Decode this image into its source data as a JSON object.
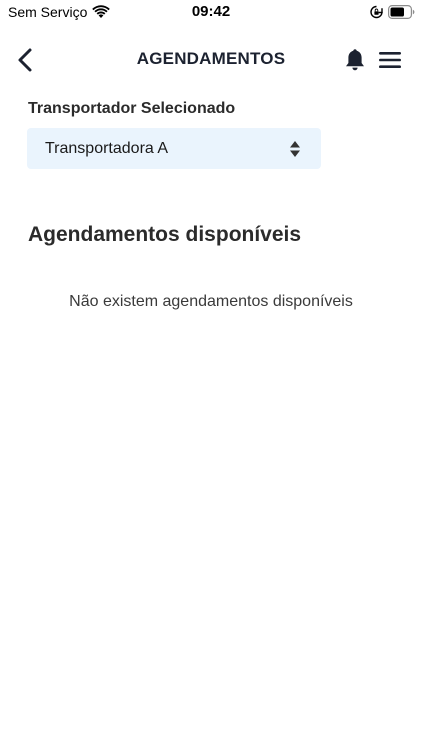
{
  "status_bar": {
    "carrier": "Sem Serviço",
    "time": "09:42",
    "icons": [
      "wifi-icon",
      "rotation-lock-icon",
      "battery-icon"
    ]
  },
  "header": {
    "title": "AGENDAMENTOS",
    "icons": [
      "back-arrow-icon",
      "bell-icon",
      "hamburger-menu-icon"
    ]
  },
  "carrier_selector": {
    "label": "Transportador Selecionado",
    "selected_value": "Transportadora A"
  },
  "appointments": {
    "title": "Agendamentos disponíveis",
    "empty_message": "Não existem agendamentos disponíveis"
  },
  "colors": {
    "select_background": "#eaf4fd",
    "title_text": "#1c2230",
    "body_text": "#2b2b2b"
  }
}
